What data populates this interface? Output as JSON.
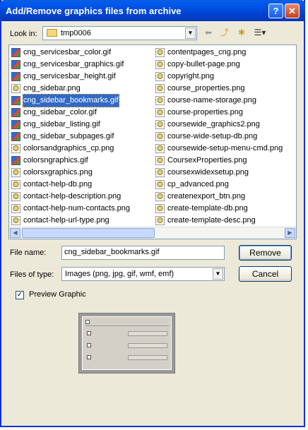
{
  "window": {
    "title": "Add/Remove graphics files from archive",
    "help_glyph": "?",
    "close_glyph": "✕"
  },
  "look_in": {
    "label": "Look in:",
    "value": "tmp0006"
  },
  "files_left": [
    {
      "name": "cng_servicesbar_color.gif",
      "type": "gif"
    },
    {
      "name": "cng_servicesbar_graphics.gif",
      "type": "gif"
    },
    {
      "name": "cng_servicesbar_height.gif",
      "type": "gif"
    },
    {
      "name": "cng_sidebar.png",
      "type": "png"
    },
    {
      "name": "cng_sidebar_bookmarks.gif",
      "type": "gif",
      "selected": true
    },
    {
      "name": "cng_sidebar_color.gif",
      "type": "gif"
    },
    {
      "name": "cng_sidebar_listing.gif",
      "type": "gif"
    },
    {
      "name": "cng_sidebar_subpages.gif",
      "type": "gif"
    },
    {
      "name": "colorsandgraphics_cp.png",
      "type": "png"
    },
    {
      "name": "colorsngraphics.gif",
      "type": "gif"
    },
    {
      "name": "colorsxgraphics.png",
      "type": "png"
    },
    {
      "name": "contact-help-db.png",
      "type": "png"
    },
    {
      "name": "contact-help-description.png",
      "type": "png"
    },
    {
      "name": "contact-help-num-contacts.png",
      "type": "png"
    },
    {
      "name": "contact-help-url-type.png",
      "type": "png"
    }
  ],
  "files_right": [
    {
      "name": "contentpages_cng.png",
      "type": "png"
    },
    {
      "name": "copy-bullet-page.png",
      "type": "png"
    },
    {
      "name": "copyright.png",
      "type": "png"
    },
    {
      "name": "course_properties.png",
      "type": "png"
    },
    {
      "name": "course-name-storage.png",
      "type": "png"
    },
    {
      "name": "course-properties.png",
      "type": "png"
    },
    {
      "name": "coursewide_graphics2.png",
      "type": "png"
    },
    {
      "name": "course-wide-setup-db.png",
      "type": "png"
    },
    {
      "name": "coursewide-setup-menu-cmd.png",
      "type": "png"
    },
    {
      "name": "CoursexProperties.png",
      "type": "png"
    },
    {
      "name": "coursexwidexsetup.png",
      "type": "png"
    },
    {
      "name": "cp_advanced.png",
      "type": "png"
    },
    {
      "name": "createnexport_btn.png",
      "type": "png"
    },
    {
      "name": "create-template-db.png",
      "type": "png"
    },
    {
      "name": "create-template-desc.png",
      "type": "png"
    }
  ],
  "file_name": {
    "label": "File name:",
    "value": "cng_sidebar_bookmarks.gif"
  },
  "file_type": {
    "label": "Files of type:",
    "value": "Images (png, jpg, gif, wmf, emf)"
  },
  "buttons": {
    "remove": "Remove",
    "cancel": "Cancel"
  },
  "preview_graphic": {
    "label": "Preview Graphic",
    "checked": true
  },
  "colors": {
    "selection": "#316ac5",
    "titlebar": "#0058ee",
    "dialog_bg": "#ece9d8"
  }
}
